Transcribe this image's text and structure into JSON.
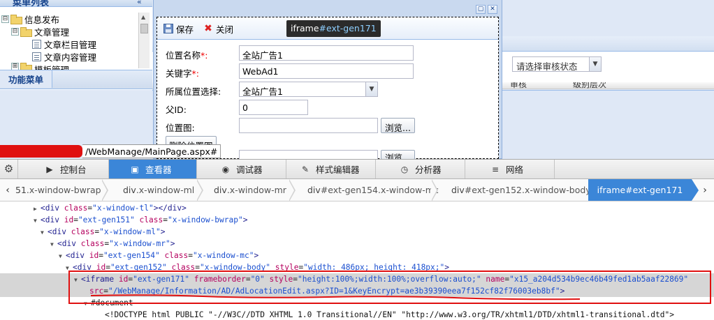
{
  "menu": {
    "title": "菜单列表",
    "collapse_icon": "double-chevron-icon",
    "tree": [
      {
        "label": "信息发布",
        "expander": "⊟",
        "type": "folder"
      },
      {
        "label": "文章管理",
        "expander": "⊟",
        "type": "folder"
      },
      {
        "label": "文章栏目管理",
        "type": "doc"
      },
      {
        "label": "文章内容管理",
        "type": "doc"
      },
      {
        "label": "模板管理",
        "expander": "⊞",
        "type": "folder"
      }
    ],
    "func_tab": "功能菜单"
  },
  "right": {
    "audit_placeholder": "请选择审核状态",
    "grid_cols": [
      "审核",
      "级别层次"
    ]
  },
  "modal": {
    "save": "保存",
    "close": "关闭",
    "tooltip_tag": "iframe",
    "tooltip_id": "#ext-gen171",
    "fields": [
      {
        "label": "位置名称",
        "required": "*:",
        "value": "全站广告1"
      },
      {
        "label": "关键字",
        "required": "*:",
        "value": "WebAd1"
      },
      {
        "label": "所属位置选择:",
        "value": "全站广告1"
      },
      {
        "label": "父ID:",
        "value": "0"
      },
      {
        "label": "位置图:",
        "value": "",
        "button": "浏览..."
      }
    ],
    "delete_image": "删除位置图",
    "browse2": "浏览..."
  },
  "url_tooltip": "/WebManage/MainPage.aspx#",
  "devtools": {
    "tabs": [
      {
        "label": "控制台",
        "icon": "▶"
      },
      {
        "label": "查看器",
        "icon": "▣"
      },
      {
        "label": "调试器",
        "icon": "◉"
      },
      {
        "label": "样式编辑器",
        "icon": "✎"
      },
      {
        "label": "分析器",
        "icon": "◷"
      },
      {
        "label": "网络",
        "icon": "≡"
      }
    ],
    "breadcrumb": [
      {
        "tag": "51",
        "cls": ".x-window-bwrap"
      },
      {
        "tag": "div",
        "cls": ".x-window-ml"
      },
      {
        "tag": "div",
        "cls": ".x-window-mr"
      },
      {
        "tag": "div",
        "cls": "#ext-gen154.x-window-mc"
      },
      {
        "tag": "div",
        "cls": "#ext-gen152.x-window-body"
      }
    ],
    "breadcrumb_active": "iframe#ext-gen171",
    "dom": [
      {
        "indent": 48,
        "tw": "▶",
        "html": "<span class=\"tg\">&lt;div</span> <span class=\"an\">class</span>=<span class=\"av\">\"x-window-tl\"</span><span class=\"tg\">&gt;&lt;/div&gt;</span>"
      },
      {
        "indent": 48,
        "tw": "▼",
        "html": "<span class=\"tg\">&lt;div</span> <span class=\"an\">id</span>=<span class=\"av\">\"ext-gen151\"</span> <span class=\"an\">class</span>=<span class=\"av\">\"x-window-bwrap\"</span><span class=\"tg\">&gt;</span>"
      },
      {
        "indent": 58,
        "tw": "▼",
        "html": "<span class=\"tg\">&lt;div</span> <span class=\"an\">class</span>=<span class=\"av\">\"x-window-ml\"</span><span class=\"tg\">&gt;</span>"
      },
      {
        "indent": 72,
        "tw": "▼",
        "html": "<span class=\"tg\">&lt;div</span> <span class=\"an\">class</span>=<span class=\"av\">\"x-window-mr\"</span><span class=\"tg\">&gt;</span>"
      },
      {
        "indent": 84,
        "tw": "▼",
        "html": "<span class=\"tg\">&lt;div</span> <span class=\"an\">id</span>=<span class=\"av\">\"ext-gen154\"</span> <span class=\"an\">class</span>=<span class=\"av\">\"x-window-mc\"</span><span class=\"tg\">&gt;</span>"
      },
      {
        "indent": 94,
        "tw": "▼",
        "html": "<span class=\"tg\">&lt;div</span> <span class=\"an\">id</span>=<span class=\"av\">\"ext-gen152\"</span> <span class=\"an\">class</span>=<span class=\"av\">\"x-window-body\"</span> <span class=\"an\">style</span>=<span class=\"av\">\"width: 486px; height: 418px;\"</span><span class=\"tg\">&gt;</span>"
      },
      {
        "indent": 106,
        "tw": "▼",
        "sel": true,
        "html": "<span class=\"tg\">&lt;iframe</span> <span class=\"an\">id</span>=<span class=\"av\">\"ext-gen171\"</span> <span class=\"an\">frameborder</span>=<span class=\"av\">\"0\"</span> <span class=\"an\">style</span>=<span class=\"av\">\"height:100%;width:100%;overflow:auto;\"</span> <span class=\"an\">name</span>=<span class=\"av\">\"x15_a204d534b9ec46b49fed1ab5aaf22869\"</span>"
      },
      {
        "indent": 118,
        "tw": "",
        "sel": true,
        "html": "<span class=\"an\">src</span>=<span class=\"av\">\"/WebManage/Information/AD/AdLocationEdit.aspx?ID=1&amp;KeyEncrypt=ae3b39390eea7f152cf82f76003eb8bf\"</span><span class=\"tg\">&gt;</span>"
      },
      {
        "indent": 120,
        "tw": "▼",
        "html": "<span class=\"txt\">#document</span>"
      },
      {
        "indent": 140,
        "tw": "",
        "html": "<span class=\"txt\">&lt;!DOCTYPE html PUBLIC \"-//W3C//DTD XHTML 1.0 Transitional//EN\" \"http://www.w3.org/TR/xhtml1/DTD/xhtml1-transitional.dtd\"&gt;</span>"
      }
    ]
  }
}
